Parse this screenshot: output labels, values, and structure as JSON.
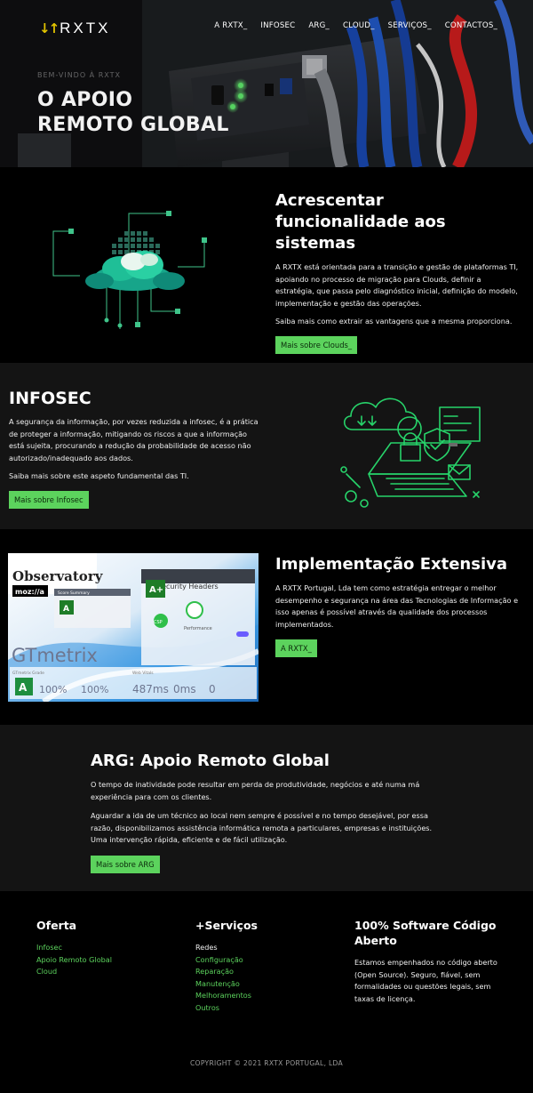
{
  "brand": {
    "arrows": "↓↑",
    "name": "RXTX"
  },
  "nav": [
    "A RXTX_",
    "INFOSEC",
    "ARG_",
    "CLOUD_",
    "SERVIÇOS_",
    "CONTACTOS_"
  ],
  "hero": {
    "kicker": "BEM-VINDO À RXTX",
    "title_line1": "O APOIO",
    "title_line2": "REMOTO GLOBAL"
  },
  "cloud": {
    "title": "Acrescentar funcionalidade aos sistemas",
    "body": "A RXTX está orientada para a transição e gestão de plataformas TI, apoiando no processo de migração para Clouds, definir a estratégia, que passa pelo diagnóstico inicial, definição do modelo, implementação e gestão das operações.",
    "note": "Saiba mais como extrair as vantagens que a mesma proporciona.",
    "button": "Mais sobre Clouds_"
  },
  "infosec": {
    "title": "INFOSEC",
    "body": "A segurança da informação, por vezes reduzida a infosec, é a prática de proteger a informação, mitigando os riscos a que a informação está sujeita, procurando a redução da probabilidade de acesso não autorizado/inadequado aos dados.",
    "note": "Saiba mais sobre este aspeto fundamental das TI.",
    "button": "Mais sobre Infosec"
  },
  "implementacao": {
    "title": "Implementação Extensiva",
    "body": "A RXTX Portugal, Lda tem como estratégia entregar o melhor desempenho e segurança na área das Tecnologias de Informação e isso apenas é possível através da qualidade dos processos implementados.",
    "button": "A RXTX_",
    "screenshot": {
      "observatory": "Observatory",
      "mozilla": "moz://a",
      "score_summary": "Score Summary",
      "grade_a": "A",
      "security_headers": "Security Headers",
      "grade_a_plus": "A+",
      "csp": "CSP",
      "performance": "Performance",
      "gtmetrix": "GTmetrix",
      "gtmetrix_grade": "GTmetrix Grade",
      "web_vitals": "Web Vitals",
      "grade_letter": "A",
      "perf_value": "100%",
      "structure_value": "100%",
      "lcp": "487ms",
      "tbt": "0ms",
      "cls": "0"
    }
  },
  "arg": {
    "title": "ARG: Apoio Remoto Global",
    "body1": "O tempo de inatividade pode resultar em perda de produtividade, negócios e até numa má experiência para com os clientes.",
    "body2": "Aguardar a ida de um técnico ao local nem sempre é possível e no tempo desejável, por essa razão, disponibilizamos assistência informática remota a particulares, empresas e instituições. Uma intervenção rápida, eficiente e de fácil utilização.",
    "button": "Mais sobre ARG"
  },
  "footer": {
    "oferta_title": "Oferta",
    "oferta_items": [
      "Infosec",
      "Apoio Remoto Global",
      "Cloud"
    ],
    "servicos_title": "+Serviços",
    "servicos_items": [
      "Redes",
      "Configuração",
      "Reparação",
      "Manutenção",
      "Melhoramentos",
      "Outros"
    ],
    "opensource_title": "100% Software Código Aberto",
    "opensource_body": "Estamos empenhados no código aberto (Open Source). Seguro, fiável, sem formalidades ou questões legais, sem taxas de licença.",
    "copyright": "COPYRIGHT © 2021 RXTX PORTUGAL, LDA"
  },
  "colors": {
    "accent": "#5cd35d",
    "logo_arrows": "#e2c400",
    "bg_dark": "#000000",
    "bg_alt": "#141414"
  }
}
